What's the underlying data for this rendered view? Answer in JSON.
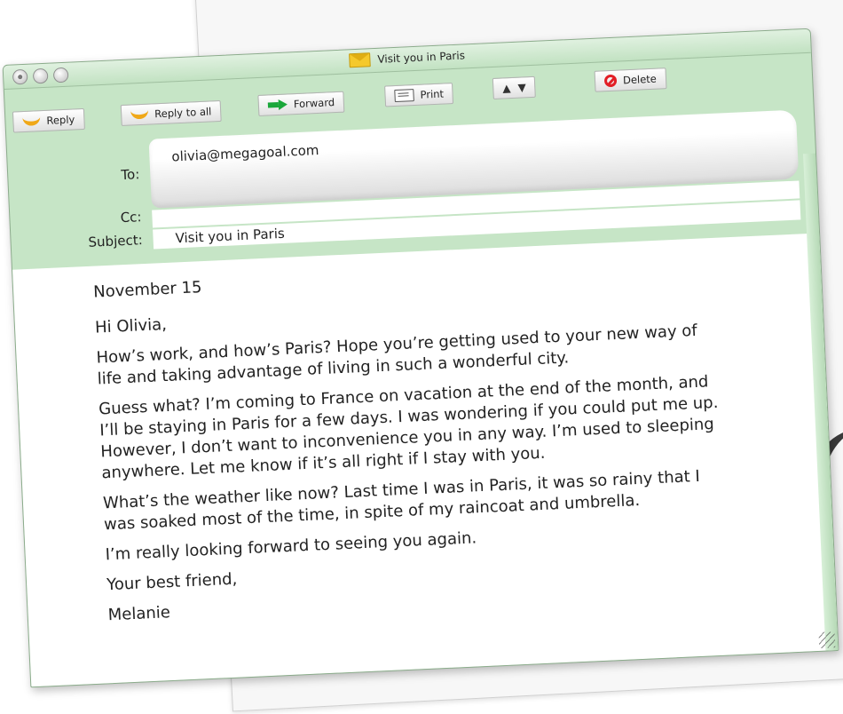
{
  "window": {
    "title": "Visit you in Paris"
  },
  "toolbar": {
    "reply": "Reply",
    "reply_all": "Reply to all",
    "forward": "Forward",
    "print": "Print",
    "delete": "Delete",
    "up_arrow": "▲",
    "down_arrow": "▼"
  },
  "fields": {
    "to_label": "To:",
    "to_value": "olivia@megagoal.com",
    "cc_label": "Cc:",
    "cc_value": "",
    "subject_label": "Subject:",
    "subject_value": "Visit you in Paris"
  },
  "message": {
    "date": "November 15",
    "greeting": "Hi Olivia,",
    "paragraphs": [
      "How’s work, and how’s Paris? Hope you’re getting used to your new way of life and taking advantage of living in such a wonderful city.",
      "Guess what? I’m coming to France on vacation at the end of the month, and I’ll be staying in Paris for a few days. I was wondering if you could put me up. However, I don’t want to inconvenience you in any way. I’m used to sleeping anywhere. Let me know if it’s all right if I stay with you.",
      "What’s the weather like now? Last time I was in Paris, it was so rainy that I was soaked most of the time, in spite of my raincoat and umbrella.",
      "I’m really looking forward to seeing you again."
    ],
    "closing": "Your best friend,",
    "signature": "Melanie"
  },
  "colors": {
    "chrome_green": "#c6e5c6",
    "reply_icon": "#f0a818",
    "forward_icon": "#1aa73a",
    "delete_icon": "#e21e26"
  }
}
